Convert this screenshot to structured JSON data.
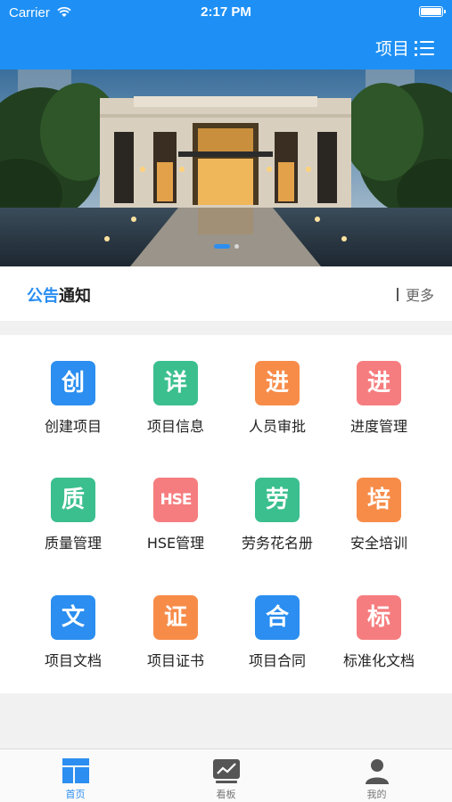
{
  "status_bar": {
    "carrier": "Carrier",
    "time": "2:17 PM"
  },
  "nav": {
    "right_label": "项目",
    "menu_icon": "list-icon"
  },
  "banner": {
    "slide_count": 2,
    "active_slide": 1
  },
  "notice": {
    "title_part1": "公告",
    "title_part2": "通知",
    "more_label": "更多"
  },
  "grid": {
    "items": [
      {
        "glyph": "创",
        "label": "创建项目",
        "color": "#2b8ef0"
      },
      {
        "glyph": "详",
        "label": "项目信息",
        "color": "#3bbf8f"
      },
      {
        "glyph": "进",
        "label": "人员审批",
        "color": "#f78c49"
      },
      {
        "glyph": "进",
        "label": "进度管理",
        "color": "#f67d7f"
      },
      {
        "glyph": "质",
        "label": "质量管理",
        "color": "#3bbf8f"
      },
      {
        "glyph": "HSE",
        "label": "HSE管理",
        "color": "#f67d7f"
      },
      {
        "glyph": "劳",
        "label": "劳务花名册",
        "color": "#3bbf8f"
      },
      {
        "glyph": "培",
        "label": "安全培训",
        "color": "#f78c49"
      },
      {
        "glyph": "文",
        "label": "项目文档",
        "color": "#2b8ef0"
      },
      {
        "glyph": "证",
        "label": "项目证书",
        "color": "#f78c49"
      },
      {
        "glyph": "合",
        "label": "项目合同",
        "color": "#2b8ef0"
      },
      {
        "glyph": "标",
        "label": "标准化文档",
        "color": "#f67d7f"
      }
    ]
  },
  "tabbar": {
    "tabs": [
      {
        "label": "首页",
        "icon": "home-grid-icon",
        "active": true
      },
      {
        "label": "看板",
        "icon": "dashboard-chart-icon",
        "active": false
      },
      {
        "label": "我的",
        "icon": "user-icon",
        "active": false
      }
    ]
  },
  "colors": {
    "primary": "#1e90f5",
    "accent": "#2c8ef0",
    "tab_inactive": "#777777"
  }
}
